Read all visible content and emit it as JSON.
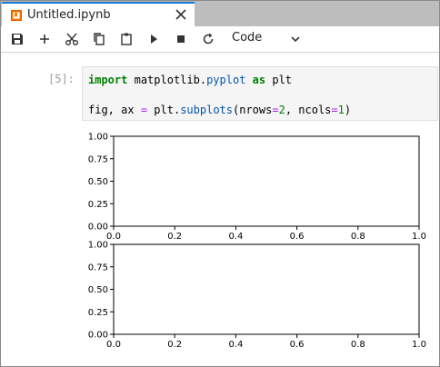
{
  "tab": {
    "title": "Untitled.ipynb",
    "icon": "notebook-icon",
    "close_icon": "close-icon"
  },
  "toolbar": {
    "buttons": [
      {
        "name": "save-button",
        "icon": "save-icon"
      },
      {
        "name": "add-cell-button",
        "icon": "plus-icon"
      },
      {
        "name": "cut-button",
        "icon": "scissors-icon"
      },
      {
        "name": "copy-button",
        "icon": "copy-icon"
      },
      {
        "name": "paste-button",
        "icon": "paste-icon"
      },
      {
        "name": "run-button",
        "icon": "play-icon"
      },
      {
        "name": "stop-button",
        "icon": "stop-icon"
      },
      {
        "name": "restart-button",
        "icon": "restart-icon"
      }
    ],
    "cell_type": "Code"
  },
  "cell": {
    "prompt": "[5]:",
    "line1": {
      "kw_import": "import",
      "module": "matplotlib",
      "dot": ".",
      "submodule": "pyplot",
      "kw_as": "as",
      "alias": "plt"
    },
    "line2": {
      "vars": "fig, ax",
      "eq": "=",
      "obj": "plt",
      "dot": ".",
      "func": "subplots",
      "open": "(",
      "arg1": "nrows",
      "eq1": "=",
      "val1": "2",
      "sep": ", ",
      "arg2": "ncols",
      "eq2": "=",
      "val2": "1",
      "close": ")"
    }
  },
  "chart_data": [
    {
      "type": "line",
      "series": [],
      "xlim": [
        0,
        1
      ],
      "ylim": [
        0,
        1
      ],
      "x_ticks": [
        "0.0",
        "0.2",
        "0.4",
        "0.6",
        "0.8",
        "1.0"
      ],
      "y_ticks": [
        "0.00",
        "0.25",
        "0.50",
        "0.75",
        "1.00"
      ]
    },
    {
      "type": "line",
      "series": [],
      "xlim": [
        0,
        1
      ],
      "ylim": [
        0,
        1
      ],
      "x_ticks": [
        "0.0",
        "0.2",
        "0.4",
        "0.6",
        "0.8",
        "1.0"
      ],
      "y_ticks": [
        "0.00",
        "0.25",
        "0.50",
        "0.75",
        "1.00"
      ]
    }
  ]
}
